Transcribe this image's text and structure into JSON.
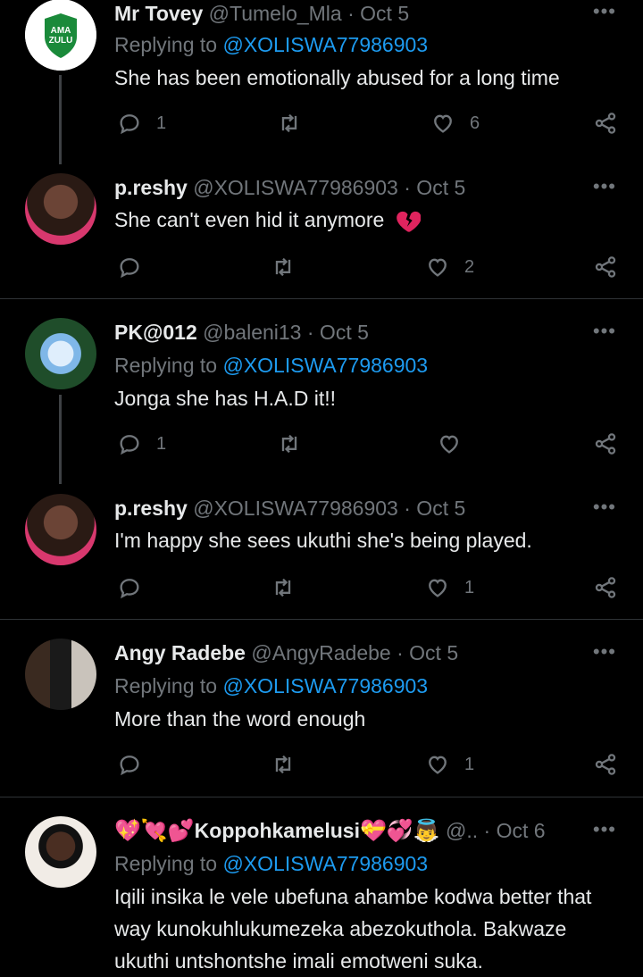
{
  "tweets": [
    {
      "name": "Mr Tovey",
      "handle": "@Tumelo_Mla",
      "date": "· Oct 5",
      "replying_label": "Replying to ",
      "replying_to": "@XOLISWA77986903",
      "text": "She has been emotionally abused for a long time",
      "replies": "1",
      "retweets": "",
      "likes": "6",
      "avatar_logo_text": "AMA ZULU"
    },
    {
      "name": "p.reshy",
      "handle": "@XOLISWA77986903",
      "date": "· Oct 5",
      "text": "She can't even hid it anymore",
      "text_emoji": "broken-heart-emoji",
      "replies": "",
      "retweets": "",
      "likes": "2"
    },
    {
      "name": "PK@012",
      "handle": "@baleni13",
      "date": "· Oct 5",
      "replying_label": "Replying to ",
      "replying_to": "@XOLISWA77986903",
      "text": "Jonga she has H.A.D it!!",
      "replies": "1",
      "retweets": "",
      "likes": ""
    },
    {
      "name": "p.reshy",
      "handle": "@XOLISWA77986903",
      "date": "· Oct 5",
      "text": "I'm happy she sees ukuthi she's being played.",
      "replies": "",
      "retweets": "",
      "likes": "1"
    },
    {
      "name": "Angy Radebe",
      "handle": "@AngyRadebe",
      "date": "· Oct 5",
      "replying_label": "Replying to ",
      "replying_to": "@XOLISWA77986903",
      "text": "More than the word enough",
      "replies": "",
      "retweets": "",
      "likes": "1"
    },
    {
      "name_prefix_emoji": "💖💘💕",
      "name": "Koppohkamelusi",
      "name_suffix_emoji": "💝💞👼",
      "handle": "@..",
      "date": "· Oct 6",
      "replying_label": "Replying to ",
      "replying_to": "@XOLISWA77986903",
      "text": "Iqili insika le vele ubefuna ahambe kodwa better that way kunokuhlukumezeka abezokuthola. Bakwaze ukuthi untshontshe imali emotweni suka."
    }
  ],
  "more_glyph": "•••",
  "colors": {
    "background": "#000000",
    "text": "#e7e9ea",
    "muted": "#71767b",
    "link": "#1d9bf0",
    "divider": "#2f3336"
  },
  "icons": [
    "reply-icon",
    "retweet-icon",
    "like-icon",
    "share-icon",
    "more-icon"
  ]
}
